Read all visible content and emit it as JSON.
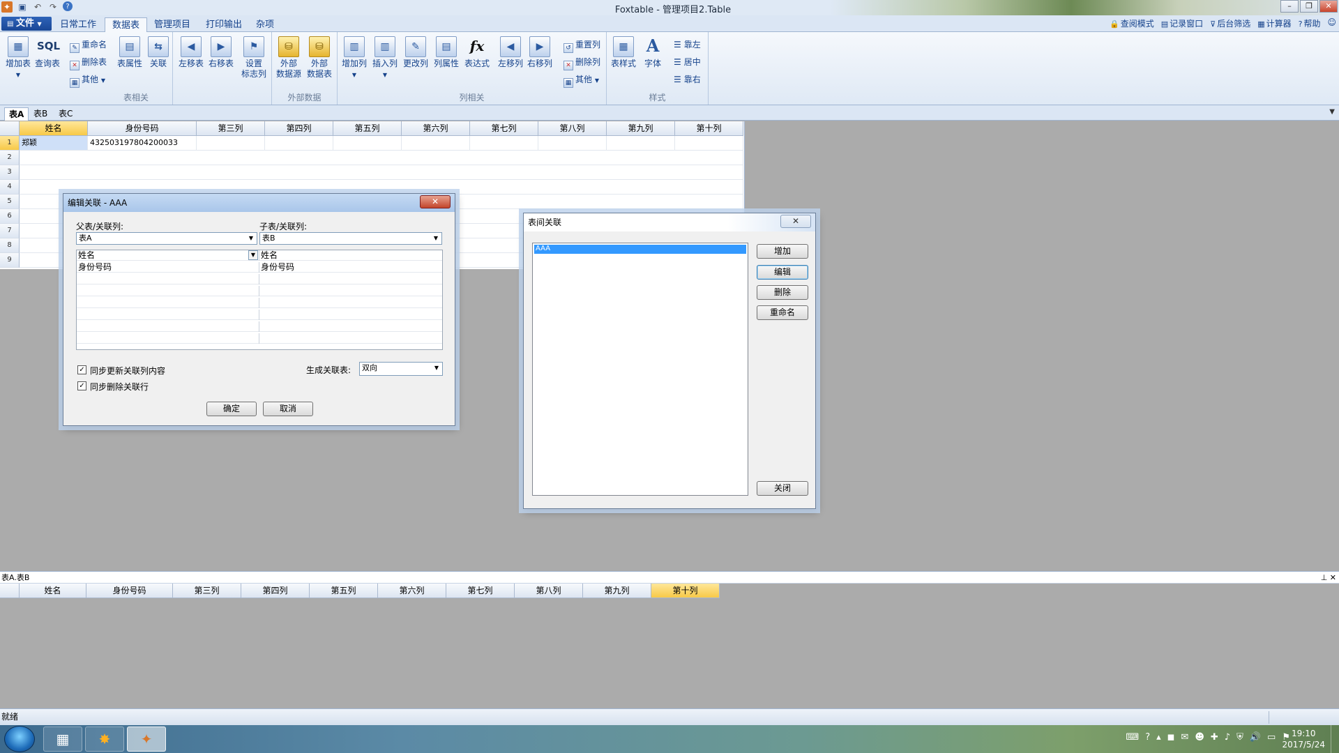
{
  "app": {
    "title": "Foxtable - 管理项目2.Table"
  },
  "title_bar": {
    "minimize": "–",
    "restore": "❐",
    "close": "✕"
  },
  "ribbon_tabs": {
    "file": "文件",
    "tabs": [
      "日常工作",
      "数据表",
      "管理项目",
      "打印输出",
      "杂项"
    ]
  },
  "right_tools": [
    "查阅模式",
    "记录窗口",
    "后台筛选",
    "计算器",
    "帮助"
  ],
  "ribbon": {
    "groups": [
      "表相关",
      "外部数据",
      "列相关",
      "样式"
    ],
    "add_table": "增加表",
    "query_table": "查询表",
    "sql": "SQL",
    "rename": "重命名",
    "delete_table": "删除表",
    "other1": "其他",
    "table_props": "表属性",
    "relation": "关联",
    "move_left_table": "左移表",
    "move_right_table": "右移表",
    "set_flag_col_1": "设置",
    "set_flag_col_2": "标志列",
    "ext_source_1": "外部",
    "ext_source_2": "数据源",
    "ext_table_1": "外部",
    "ext_table_2": "数据表",
    "add_col": "增加列",
    "insert_col": "插入列",
    "change_col": "更改列",
    "col_props": "列属性",
    "expression": "表达式",
    "expression_glyph": "fx",
    "move_left_col": "左移列",
    "move_right_col": "右移列",
    "reset_col": "重置列",
    "delete_col": "删除列",
    "other2": "其他",
    "table_style": "表样式",
    "font": "字体",
    "font_glyph": "A",
    "align_left": "靠左",
    "align_center": "居中",
    "align_right": "靠右"
  },
  "sheet_tabs": [
    "表A",
    "表B",
    "表C"
  ],
  "grid": {
    "columns": [
      "姓名",
      "身份号码",
      "第三列",
      "第四列",
      "第五列",
      "第六列",
      "第七列",
      "第八列",
      "第九列",
      "第十列"
    ],
    "row_numbers": [
      "1",
      "2",
      "3",
      "4",
      "5",
      "6",
      "7",
      "8",
      "9"
    ],
    "rows": [
      [
        "郑颖",
        "432503197804200033"
      ]
    ]
  },
  "relation_panel": {
    "title": "表A.表B",
    "pin": "⊥ ✕",
    "columns": [
      "姓名",
      "身份号码",
      "第三列",
      "第四列",
      "第五列",
      "第六列",
      "第七列",
      "第八列",
      "第九列",
      "第十列"
    ]
  },
  "edit_dialog": {
    "title": "编辑关联 - AAA",
    "close": "✕",
    "parent_label": "父表/关联列:",
    "child_label": "子表/关联列:",
    "parent_table": "表A",
    "child_table": "表B",
    "mappings": [
      [
        "姓名",
        "姓名"
      ],
      [
        "身份号码",
        "身份号码"
      ]
    ],
    "sync_update": "同步更新关联列内容",
    "sync_delete": "同步删除关联行",
    "gen_label": "生成关联表:",
    "gen_value": "双向",
    "ok": "确定",
    "cancel": "取消"
  },
  "rel_dialog": {
    "title": "表间关联",
    "close": "✕",
    "items": [
      "AAA"
    ],
    "add": "增加",
    "edit": "编辑",
    "delete": "删除",
    "rename": "重命名",
    "close_btn": "关闭"
  },
  "status": {
    "text": "就绪"
  },
  "taskbar": {
    "time": "19:10",
    "date": "2017/5/24"
  }
}
